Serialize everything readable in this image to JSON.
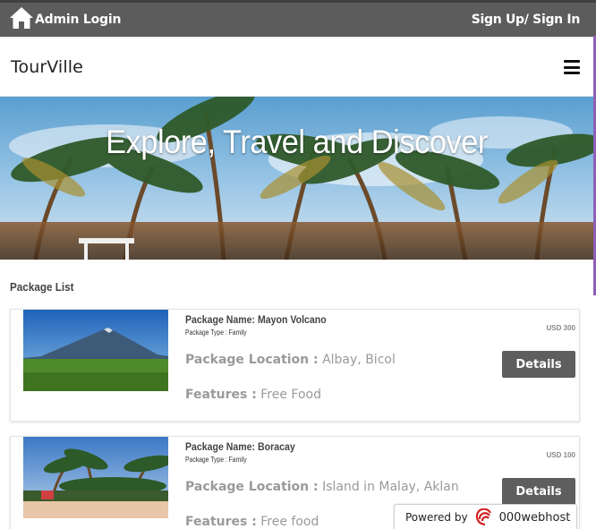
{
  "topbar": {
    "admin_label": "Admin Login",
    "signup_label": "Sign Up/ Sign In",
    "home_icon": "home-icon"
  },
  "nav": {
    "brand": "TourVille",
    "menu_icon": "hamburger-menu-icon"
  },
  "hero": {
    "headline": "Explore, Travel and Discover"
  },
  "package_section": {
    "title": "Package List",
    "packages": [
      {
        "name_label": "Package Name:",
        "name": "Mayon Volcano",
        "type_label": "Package Type :",
        "type": "Family",
        "location_label": "Package Location :",
        "location": "Albay, Bicol",
        "features_label": "Features :",
        "features": "Free Food",
        "price": "USD 300",
        "details_label": "Details"
      },
      {
        "name_label": "Package Name:",
        "name": "Boracay",
        "type_label": "Package Type :",
        "type": "Family",
        "location_label": "Package Location :",
        "location": "Island in Malay, Aklan",
        "features_label": "Features :",
        "features": "Free food",
        "price": "USD 100",
        "details_label": "Details"
      }
    ]
  },
  "badge": {
    "powered_by": "Powered by",
    "host": "000webhost"
  },
  "colors": {
    "topbar": "#5c5c5c",
    "button": "#5e5e5e",
    "accent_edge": "#8e5fb8",
    "muted_text": "#9a9a9a"
  }
}
